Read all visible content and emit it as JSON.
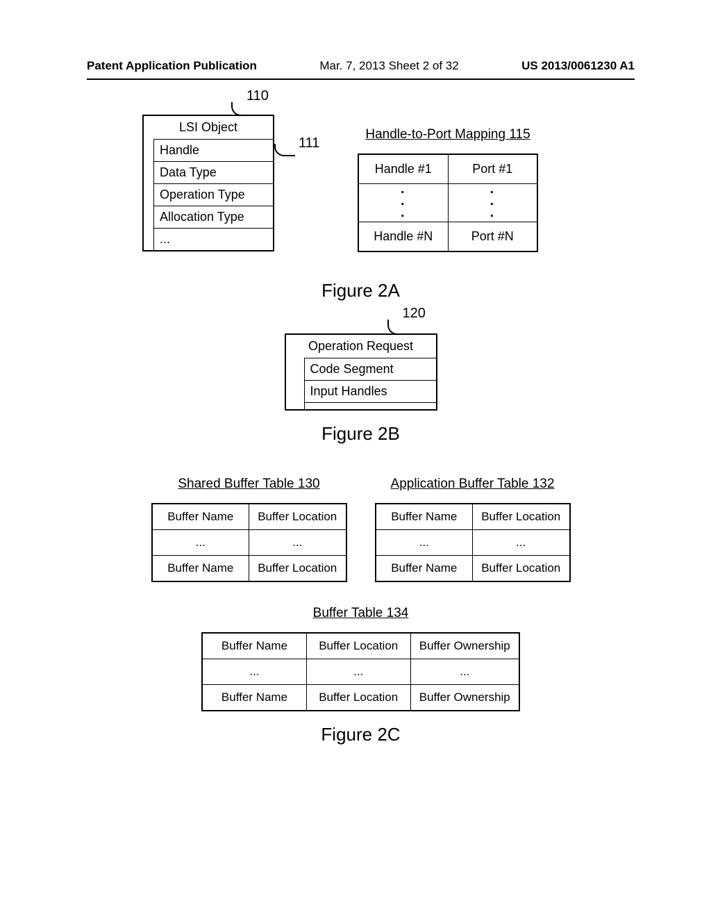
{
  "header": {
    "left": "Patent Application Publication",
    "mid": "Mar. 7, 2013  Sheet 2 of 32",
    "right": "US 2013/0061230 A1"
  },
  "fig2a": {
    "lsi": {
      "callout110": "110",
      "callout111": "111",
      "title": "LSI Object",
      "rows": [
        "Handle",
        "Data Type",
        "Operation Type",
        "Allocation Type",
        "..."
      ]
    },
    "hpm": {
      "title": "Handle-to-Port Mapping 115",
      "row1": {
        "h": "Handle #1",
        "p": "Port #1"
      },
      "dots": {
        "h": "·",
        "p": "·"
      },
      "rowN": {
        "h": "Handle #N",
        "p": "Port #N"
      }
    },
    "label": "Figure 2A"
  },
  "fig2b": {
    "callout": "120",
    "title": "Operation Request",
    "rows": [
      "Code Segment",
      "Input Handles"
    ],
    "label": "Figure 2B"
  },
  "fig2c": {
    "sbt": {
      "title": "Shared Buffer Table 130",
      "h1": "Buffer Name",
      "h2": "Buffer Location",
      "d1": "...",
      "d2": "...",
      "b1": "Buffer Name",
      "b2": "Buffer Location"
    },
    "abt": {
      "title": "Application Buffer Table 132",
      "h1": "Buffer Name",
      "h2": "Buffer Location",
      "d1": "...",
      "d2": "...",
      "b1": "Buffer Name",
      "b2": "Buffer Location"
    },
    "bt": {
      "title": "Buffer Table 134",
      "h1": "Buffer Name",
      "h2": "Buffer Location",
      "h3": "Buffer Ownership",
      "d1": "...",
      "d2": "...",
      "d3": "...",
      "b1": "Buffer Name",
      "b2": "Buffer Location",
      "b3": "Buffer Ownership"
    },
    "label": "Figure 2C"
  }
}
